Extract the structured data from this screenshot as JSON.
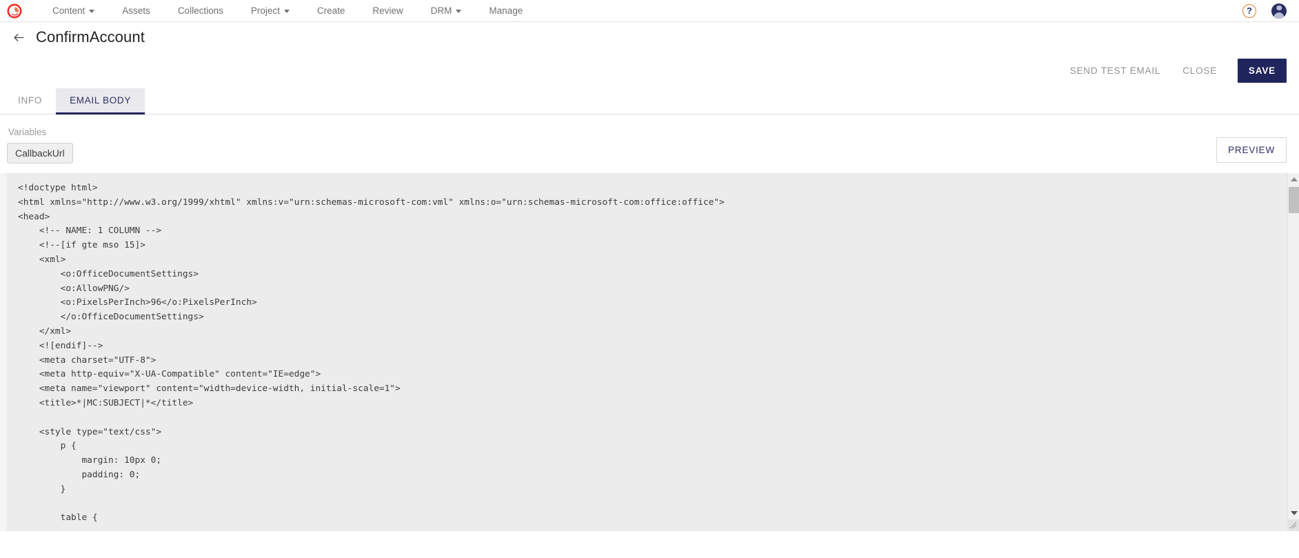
{
  "brand": {
    "logo_name": "logo-icon",
    "accent": "#ee2d24",
    "navy": "#20255c",
    "orange": "#f07d22"
  },
  "topnav": {
    "items": [
      {
        "label": "Content",
        "has_caret": true
      },
      {
        "label": "Assets",
        "has_caret": false
      },
      {
        "label": "Collections",
        "has_caret": false
      },
      {
        "label": "Project",
        "has_caret": true
      },
      {
        "label": "Create",
        "has_caret": false
      },
      {
        "label": "Review",
        "has_caret": false
      },
      {
        "label": "DRM",
        "has_caret": true
      },
      {
        "label": "Manage",
        "has_caret": false
      }
    ],
    "help_label": "?",
    "help_icon": "question-mark-circle-icon",
    "avatar_icon": "user-avatar-icon"
  },
  "header": {
    "back_icon": "arrow-left-icon",
    "title": "ConfirmAccount"
  },
  "actions": {
    "send_test_email": "SEND TEST EMAIL",
    "close": "CLOSE",
    "save": "SAVE"
  },
  "tabs": [
    {
      "label": "INFO",
      "active": false
    },
    {
      "label": "EMAIL BODY",
      "active": true
    }
  ],
  "variables": {
    "label": "Variables",
    "chips": [
      "CallbackUrl"
    ],
    "preview_label": "PREVIEW"
  },
  "editor": {
    "language": "html",
    "scrollbar": {
      "up_icon": "scroll-up-arrow-icon",
      "down_icon": "scroll-down-arrow-icon",
      "thumb": "scrollbar-thumb",
      "resize_icon": "resize-grip-icon"
    },
    "content": "<!doctype html>\n<html xmlns=\"http://www.w3.org/1999/xhtml\" xmlns:v=\"urn:schemas-microsoft-com:vml\" xmlns:o=\"urn:schemas-microsoft-com:office:office\">\n<head>\n    <!-- NAME: 1 COLUMN -->\n    <!--[if gte mso 15]>\n    <xml>\n        <o:OfficeDocumentSettings>\n        <o:AllowPNG/>\n        <o:PixelsPerInch>96</o:PixelsPerInch>\n        </o:OfficeDocumentSettings>\n    </xml>\n    <![endif]-->\n    <meta charset=\"UTF-8\">\n    <meta http-equiv=\"X-UA-Compatible\" content=\"IE=edge\">\n    <meta name=\"viewport\" content=\"width=device-width, initial-scale=1\">\n    <title>*|MC:SUBJECT|*</title>\n\n    <style type=\"text/css\">\n        p {\n            margin: 10px 0;\n            padding: 0;\n        }\n\n        table {"
  }
}
